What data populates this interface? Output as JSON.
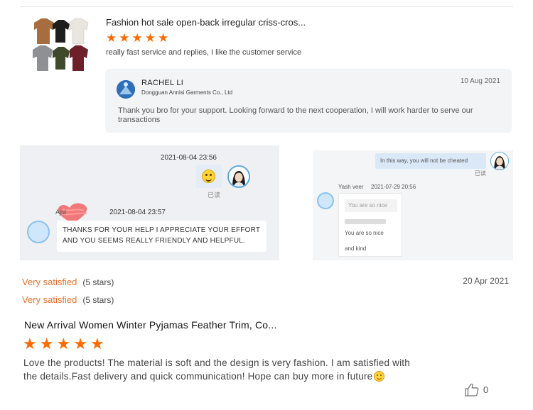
{
  "review1": {
    "product_title": "Fashion hot sale open-back irregular criss-cros...",
    "rating_stars": 5,
    "text": "really fast service and replies, I like the customer service",
    "seller_reply": {
      "name": "RACHEL LI",
      "company": "Dongguan Annisi Garments Co., Ltd",
      "date": "10 Aug 2021",
      "message": "Thank you bro for your support. Looking forward to the next cooperation, I will work harder to serve our transactions"
    }
  },
  "chat1": {
    "timestamp_top": "2021-08-04 23:56",
    "read_status": "已读",
    "sender_name": "Ajul",
    "timestamp_bottom": "2021-08-04 23:57",
    "message": "THANKS FOR YOUR HELP I APPRECIATE YOUR EFFORT AND YOU SEEMS REALLY FRIENDLY AND HELPFUL."
  },
  "chat2": {
    "outgoing_message": "In this way, you will not be cheated",
    "read_status": "已读",
    "sender_name": "Yash veer",
    "timestamp": "2021-07-29 20:56",
    "quoted_text": "You are so nice",
    "reply_line1": "You are so nice",
    "reply_line2": "and kind"
  },
  "review2": {
    "satisfaction": [
      {
        "label": "Very satisfied",
        "count": "(5 stars)"
      },
      {
        "label": "Very satisfied",
        "count": "(5 stars)"
      }
    ],
    "date": "20 Apr 2021",
    "product_title": "New Arrival Women Winter Pyjamas Feather Trim, Co...",
    "rating_stars": 5,
    "text": "Love the products! The material is soft and the design is very fashion. I am satisfied with the details.Fast delivery and quick communication! Hope can buy more in future",
    "like_count": "0"
  },
  "colors": {
    "star": "#ff6a00",
    "satisfaction_label": "#e8712b",
    "reply_background": "#f3f4f6"
  },
  "icons": [
    "star-icon",
    "seller-avatar-icon",
    "smile-emoji-icon",
    "thumbs-up-icon"
  ]
}
